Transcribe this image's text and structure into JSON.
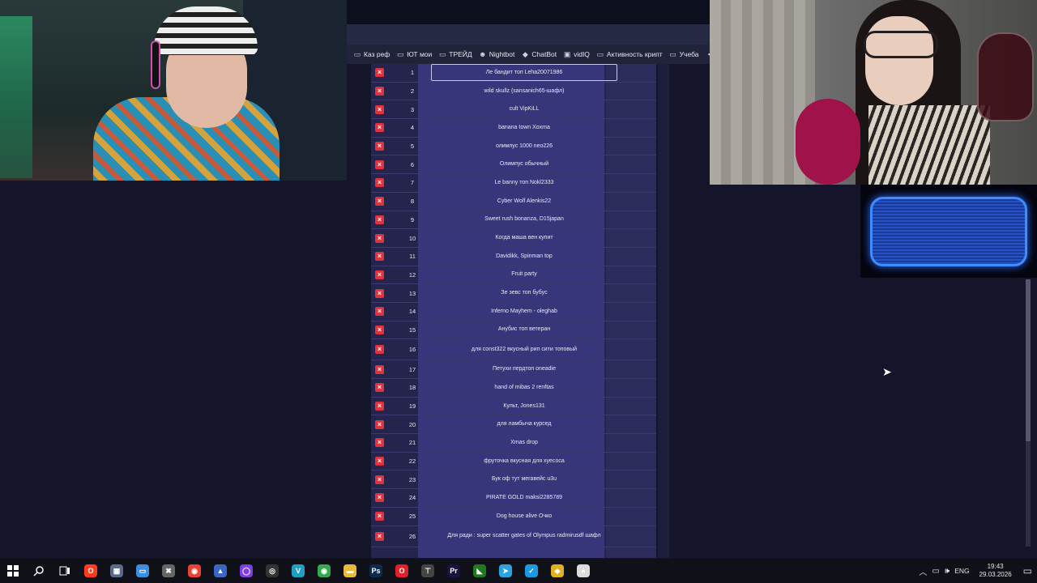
{
  "bookmarks": [
    {
      "icon": "folder-icon",
      "label": "Каз реф"
    },
    {
      "icon": "folder-icon",
      "label": "ЮТ мои"
    },
    {
      "icon": "folder-icon",
      "label": "ТРЕЙД"
    },
    {
      "icon": "bot-icon",
      "label": "Nightbot"
    },
    {
      "icon": "diamond-icon",
      "label": "ChatBot"
    },
    {
      "icon": "vidiq-icon",
      "label": "vidIQ"
    },
    {
      "icon": "folder-icon",
      "label": "Активность крипт"
    },
    {
      "icon": "folder-icon",
      "label": "Учеба"
    },
    {
      "icon": "di-icon",
      "label": "Di"
    }
  ],
  "rows": [
    {
      "num": "1",
      "name": "Ле бандит топ Leha20071986"
    },
    {
      "num": "2",
      "name": "wild skullz (sansanich65-шафл)"
    },
    {
      "num": "3",
      "name": "cult VipKiLL"
    },
    {
      "num": "4",
      "name": "banana town Xoxma"
    },
    {
      "num": "5",
      "name": "олимпус 1000 neo226"
    },
    {
      "num": "6",
      "name": "Олимпус обычный"
    },
    {
      "num": "7",
      "name": "Le banny топ Nokl2333"
    },
    {
      "num": "8",
      "name": "Cyber Wolf Alenkis22"
    },
    {
      "num": "9",
      "name": "Sweet rush bonanza, D15japan"
    },
    {
      "num": "10",
      "name": "Когда маша вен купит"
    },
    {
      "num": "11",
      "name": "Davidikk, Spinman top"
    },
    {
      "num": "12",
      "name": "Fruit party"
    },
    {
      "num": "13",
      "name": "Зе зевс топ бубус"
    },
    {
      "num": "14",
      "name": "Inferno Mayhem - oleghab"
    },
    {
      "num": "15",
      "name": "Анубис топ ветеран"
    },
    {
      "num": "16",
      "name": "для const322 вкусный рип сити топовый"
    },
    {
      "num": "17",
      "name": "Петухи пердтоп oneadie"
    },
    {
      "num": "18",
      "name": "hand of mibas 2 renftas"
    },
    {
      "num": "19",
      "name": "Культ, Jones131"
    },
    {
      "num": "20",
      "name": "для ламбыча курсед"
    },
    {
      "num": "21",
      "name": "Xmas drop"
    },
    {
      "num": "22",
      "name": "фруточка вкусная для хуесоса"
    },
    {
      "num": "23",
      "name": "Бук оф тут мегавейс u3u"
    },
    {
      "num": "24",
      "name": "PIRATE GOLD maksi2285789"
    },
    {
      "num": "25",
      "name": "Dog house alive Очко"
    },
    {
      "num": "26",
      "name": "Для ради : super scatter gates of Olympus radmirusdf шафл"
    }
  ],
  "taskbar": {
    "apps": [
      {
        "name": "opera-gx-icon",
        "color": "#ff3b1f",
        "glyph": "O"
      },
      {
        "name": "app-icon",
        "color": "#5a6a8a",
        "glyph": "▦"
      },
      {
        "name": "explorer-alt-icon",
        "color": "#3b8fe0",
        "glyph": "▭"
      },
      {
        "name": "game-icon",
        "color": "#666666",
        "glyph": "✖"
      },
      {
        "name": "chrome-icon",
        "color": "#ea4335",
        "glyph": "◉"
      },
      {
        "name": "app-icon",
        "color": "#3b66c4",
        "glyph": "▲"
      },
      {
        "name": "obs-icon",
        "color": "#7b3fe4",
        "glyph": "◯"
      },
      {
        "name": "app-icon",
        "color": "#333333",
        "glyph": "◎"
      },
      {
        "name": "v-app-icon",
        "color": "#1fa0c0",
        "glyph": "V"
      },
      {
        "name": "chrome-icon",
        "color": "#34a853",
        "glyph": "◉"
      },
      {
        "name": "folder-icon",
        "color": "#e8b93a",
        "glyph": "▬"
      },
      {
        "name": "photoshop-icon",
        "color": "#0d2a4d",
        "glyph": "Ps"
      },
      {
        "name": "opera-icon",
        "color": "#e0202a",
        "glyph": "O"
      },
      {
        "name": "app-icon",
        "color": "#444444",
        "glyph": "⊤"
      },
      {
        "name": "premiere-icon",
        "color": "#1a1240",
        "glyph": "Pr"
      },
      {
        "name": "nvidia-icon",
        "color": "#1f7a1f",
        "glyph": "◣"
      },
      {
        "name": "telegram-icon",
        "color": "#2aa3e0",
        "glyph": "➤"
      },
      {
        "name": "app-icon",
        "color": "#1b9ae0",
        "glyph": "✓"
      },
      {
        "name": "app-icon",
        "color": "#e0b020",
        "glyph": "◆"
      },
      {
        "name": "app-icon",
        "color": "#dddddd",
        "glyph": "●"
      }
    ],
    "lang": "ENG",
    "time": "19:43",
    "date": "29.03.2026"
  }
}
